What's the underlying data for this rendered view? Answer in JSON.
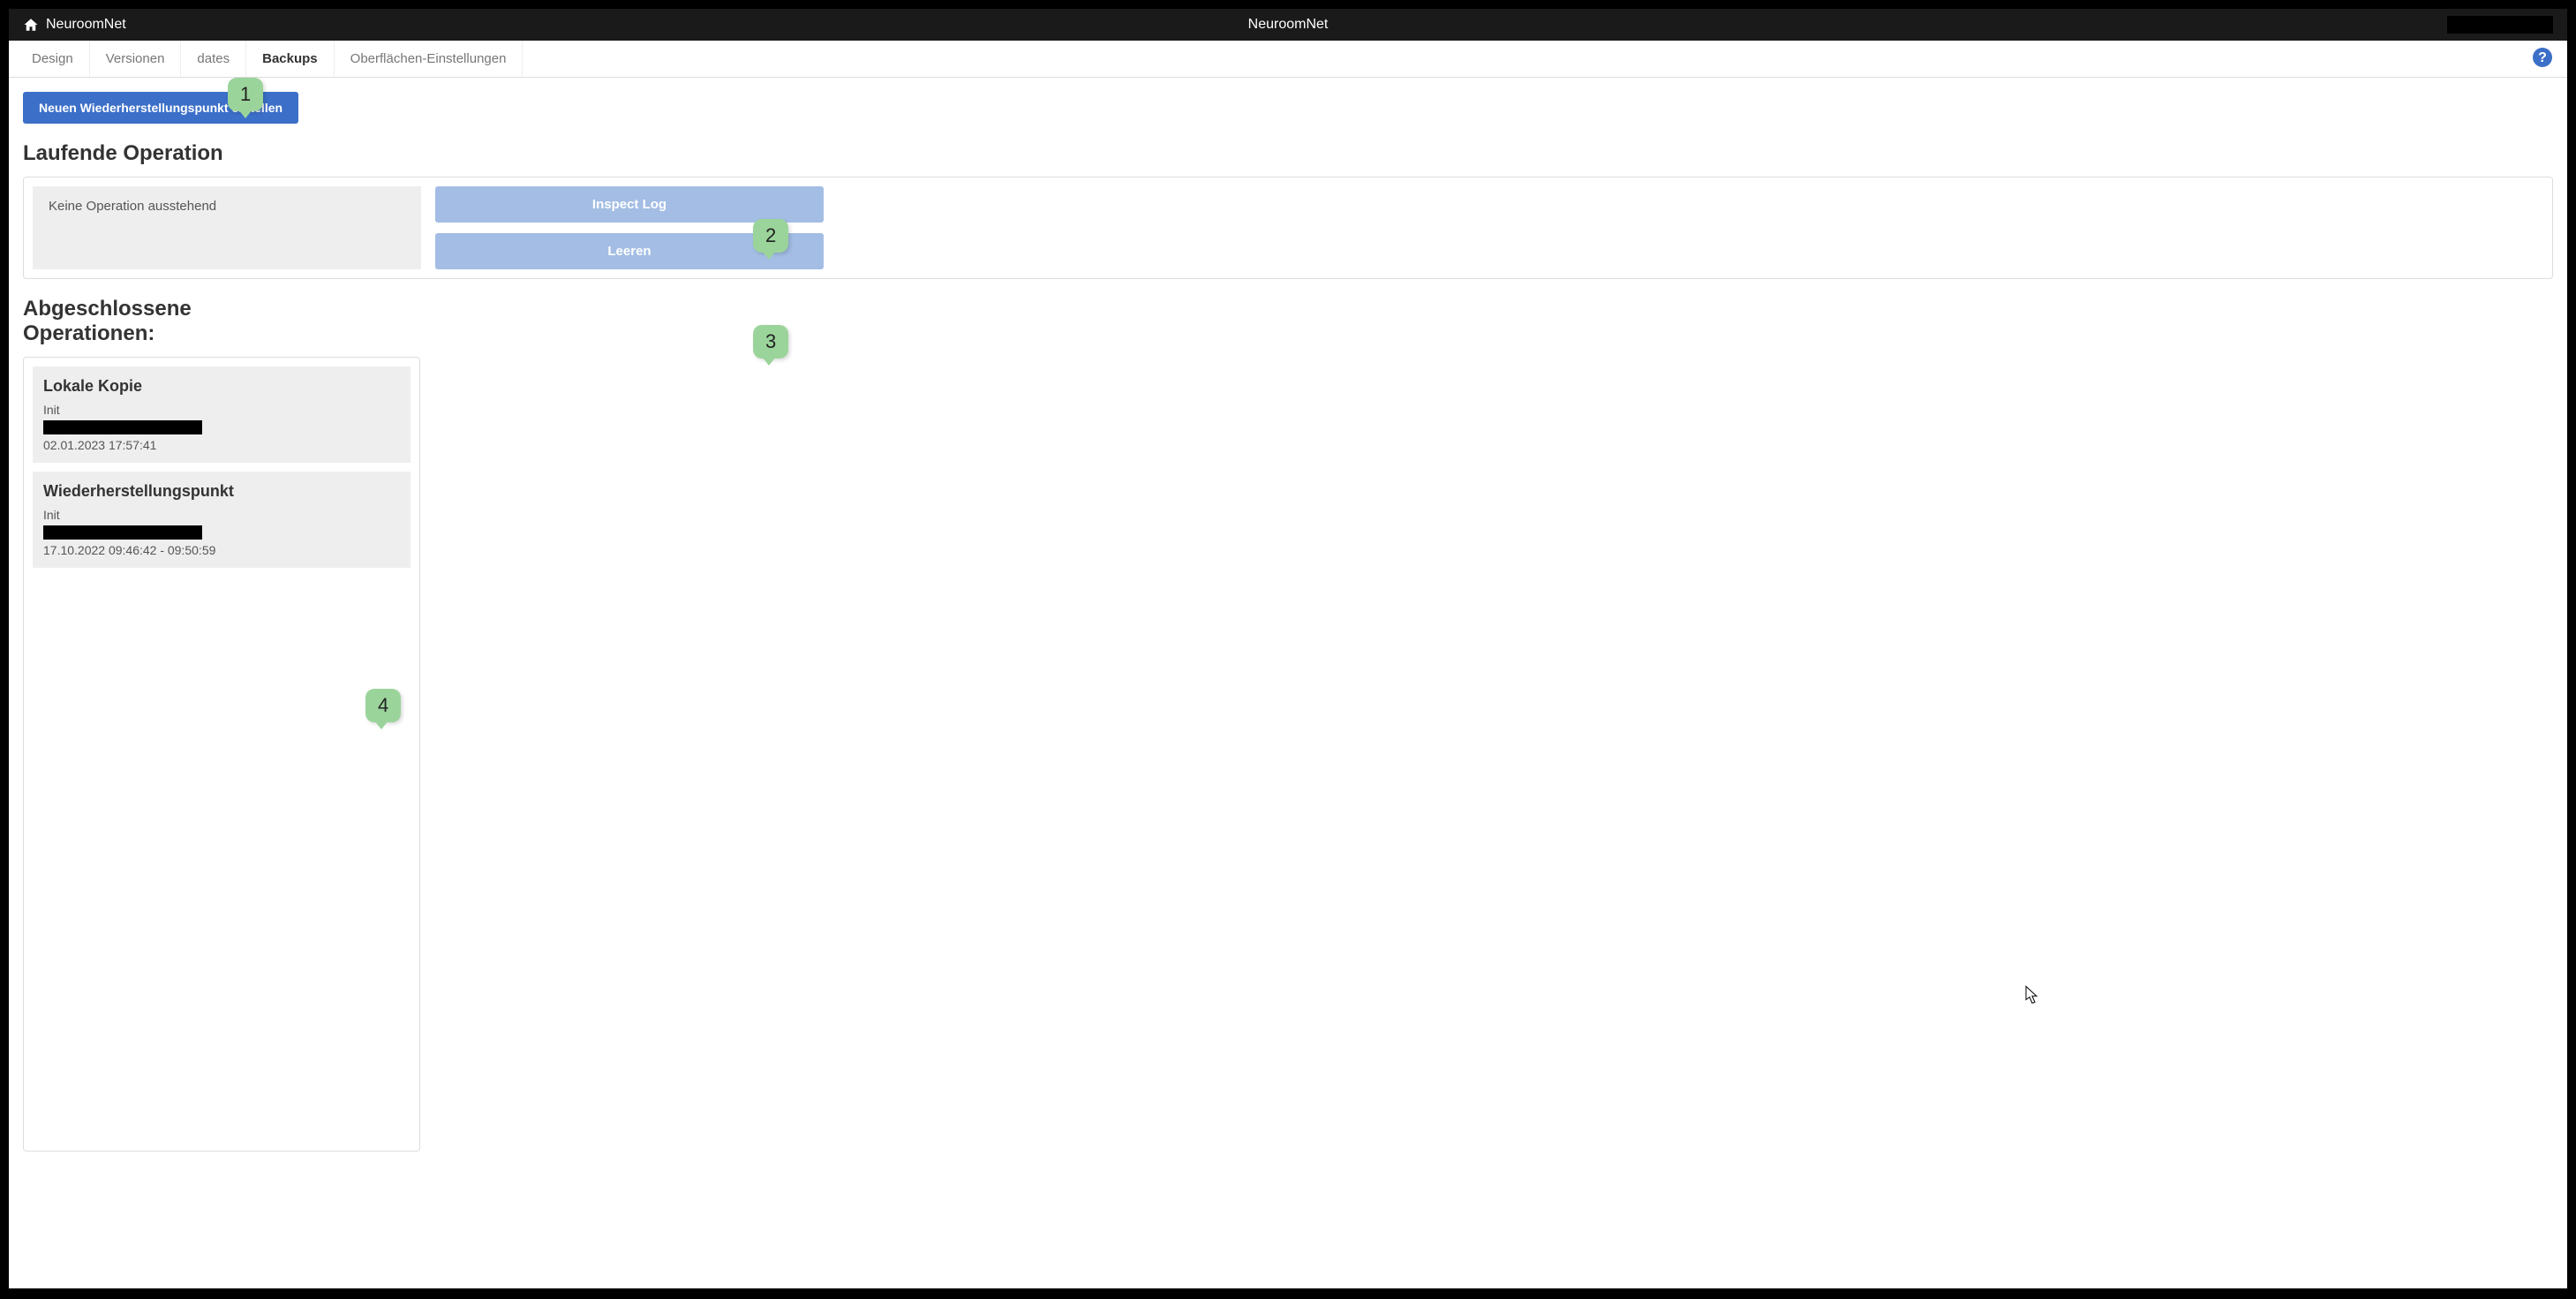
{
  "header": {
    "appName": "NeuroomNet",
    "titleCenter": "NeuroomNet"
  },
  "tabs": {
    "items": [
      {
        "label": "Design"
      },
      {
        "label": "Versionen"
      },
      {
        "label": "dates"
      },
      {
        "label": "Backups"
      },
      {
        "label": "Oberflächen-Einstellungen"
      }
    ]
  },
  "actions": {
    "createRestorePoint": "Neuen Wiederherstellungspunkt erstellen"
  },
  "running": {
    "title": "Laufende Operation",
    "status": "Keine Operation ausstehend",
    "inspectLogBtn": "Inspect Log",
    "clearBtn": "Leeren"
  },
  "completed": {
    "title": "Abgeschlossene Operationen:",
    "items": [
      {
        "title": "Lokale Kopie",
        "sub": "Init",
        "date": "02.01.2023 17:57:41"
      },
      {
        "title": "Wiederherstellungspunkt",
        "sub": "Init",
        "date": "17.10.2022 09:46:42 - 09:50:59"
      }
    ]
  },
  "callouts": {
    "c1": "1",
    "c2": "2",
    "c3": "3",
    "c4": "4"
  }
}
